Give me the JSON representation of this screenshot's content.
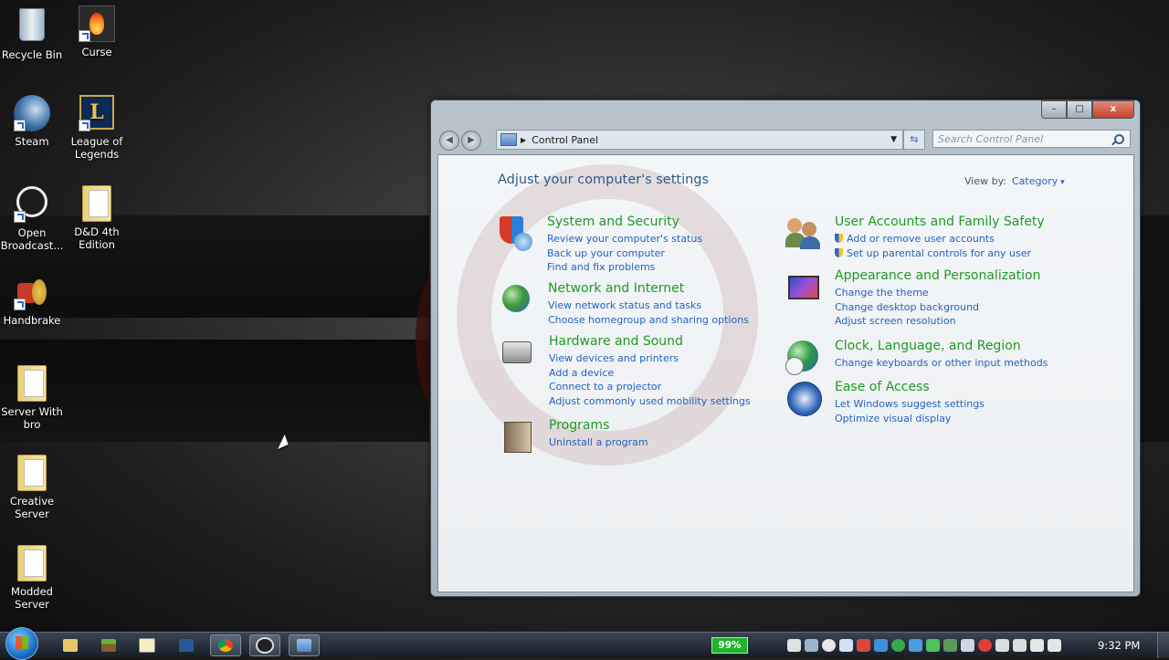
{
  "desktop": {
    "icons": [
      {
        "label": "Recycle Bin"
      },
      {
        "label": "Curse"
      },
      {
        "label": "Steam"
      },
      {
        "label": "League of Legends"
      },
      {
        "label": "Open Broadcast..."
      },
      {
        "label": "D&D 4th Edition"
      },
      {
        "label": "Handbrake"
      },
      {
        "label": "Server With bro"
      },
      {
        "label": "Creative Server"
      },
      {
        "label": "Modded Server"
      }
    ]
  },
  "window": {
    "title_buttons": {
      "minimize": "–",
      "maximize": "□",
      "close": "x"
    },
    "address": {
      "location": "Control Panel"
    },
    "search": {
      "placeholder": "Search Control Panel"
    },
    "heading": "Adjust your computer's settings",
    "view_by": {
      "label": "View by:",
      "value": "Category"
    },
    "categories_left": [
      {
        "title": "System and Security",
        "links": [
          "Review your computer's status",
          "Back up your computer",
          "Find and fix problems"
        ]
      },
      {
        "title": "Network and Internet",
        "links": [
          "View network status and tasks",
          "Choose homegroup and sharing options"
        ]
      },
      {
        "title": "Hardware and Sound",
        "links": [
          "View devices and printers",
          "Add a device",
          "Connect to a projector",
          "Adjust commonly used mobility settings"
        ]
      },
      {
        "title": "Programs",
        "links": [
          "Uninstall a program"
        ]
      }
    ],
    "categories_right": [
      {
        "title": "User Accounts and Family Safety",
        "links": [
          "Add or remove user accounts",
          "Set up parental controls for any user"
        ]
      },
      {
        "title": "Appearance and Personalization",
        "links": [
          "Change the theme",
          "Change desktop background",
          "Adjust screen resolution"
        ]
      },
      {
        "title": "Clock, Language, and Region",
        "links": [
          "Change keyboards or other input methods"
        ]
      },
      {
        "title": "Ease of Access",
        "links": [
          "Let Windows suggest settings",
          "Optimize visual display"
        ]
      }
    ]
  },
  "taskbar": {
    "battery": "99%",
    "clock": "9:32 PM",
    "colors": {
      "green_link": "#1e9b24",
      "blue_link": "#2463be"
    }
  }
}
